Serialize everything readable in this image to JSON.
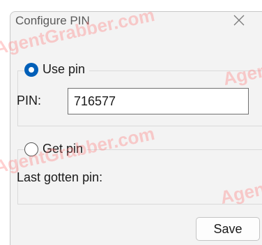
{
  "dialog": {
    "title": "Configure PIN",
    "close_icon": "close-icon"
  },
  "use_pin": {
    "label": "Use pin",
    "checked": true,
    "pin_label": "PIN:",
    "pin_value": "716577"
  },
  "get_pin": {
    "label": "Get pin",
    "checked": false,
    "last_label": "Last gotten pin:"
  },
  "buttons": {
    "save": "Save"
  },
  "watermark": {
    "text": "AgentGrabber.com"
  },
  "colors": {
    "accent": "#005fb8",
    "dialog_bg": "#f3f3f3"
  }
}
